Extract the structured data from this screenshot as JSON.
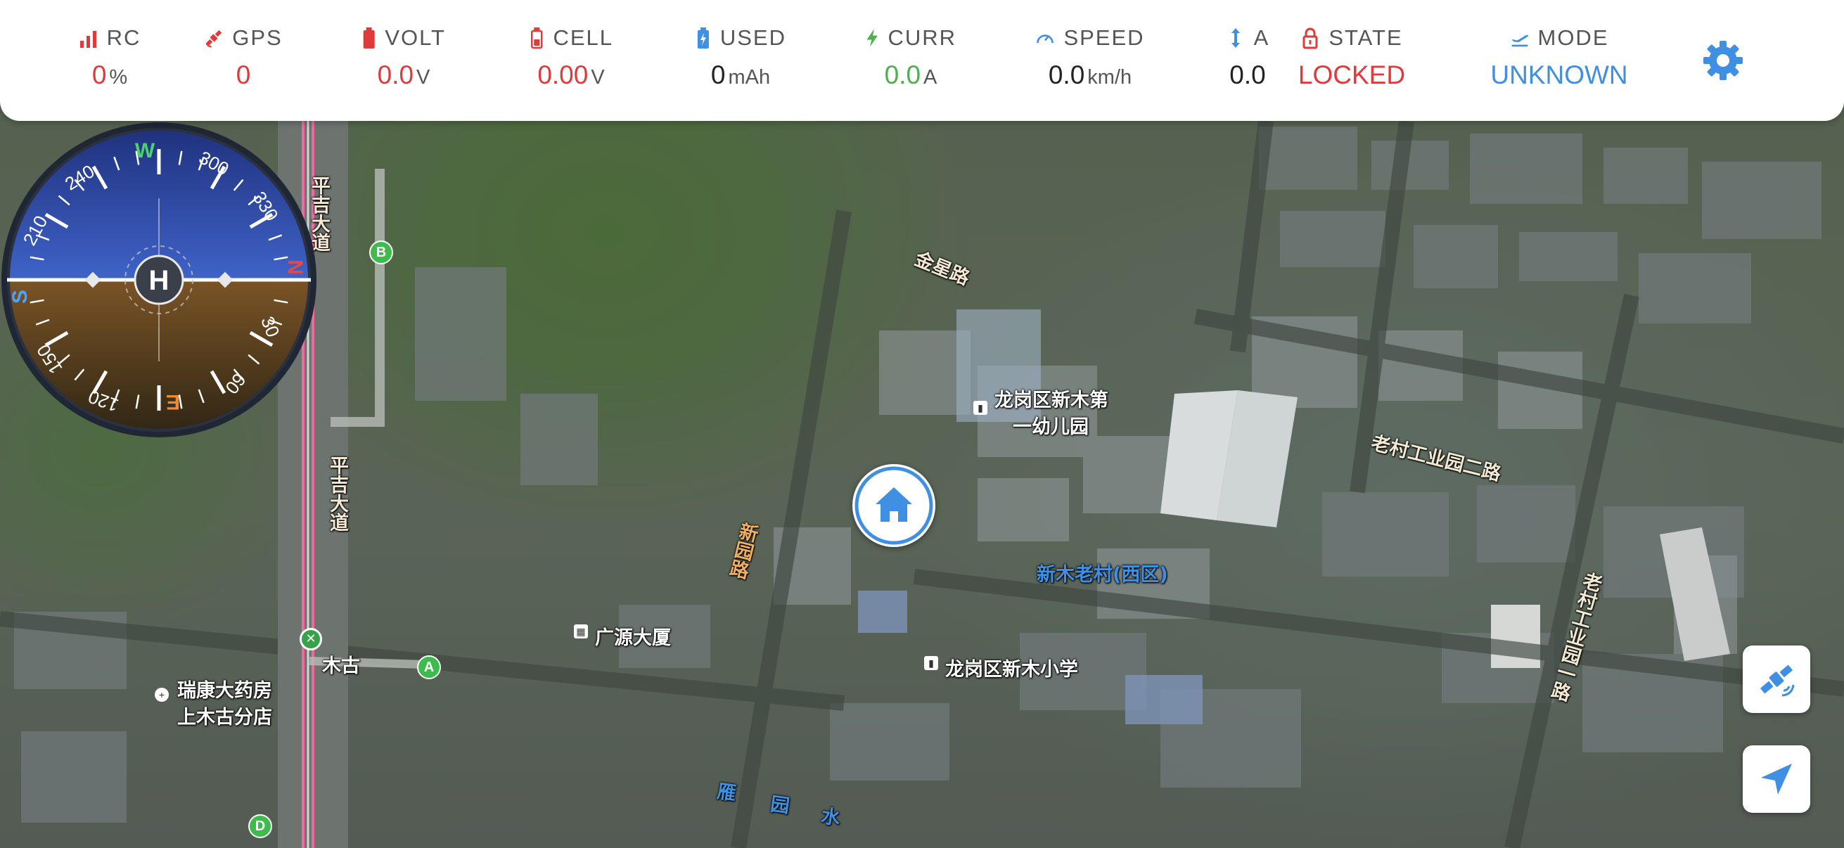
{
  "stats": [
    {
      "id": "rc",
      "label": "RC",
      "value": "0",
      "unit": "%",
      "icon": "signal-bars-icon"
    },
    {
      "id": "gps",
      "label": "GPS",
      "value": "0",
      "unit": "",
      "icon": "satellite-icon"
    },
    {
      "id": "volt",
      "label": "VOLT",
      "value": "0.0",
      "unit": "V",
      "icon": "battery-icon"
    },
    {
      "id": "cell",
      "label": "CELL",
      "value": "0.00",
      "unit": "V",
      "icon": "battery-cell-icon"
    },
    {
      "id": "used",
      "label": "USED",
      "value": "0",
      "unit": "mAh",
      "icon": "battery-charging-icon"
    },
    {
      "id": "curr",
      "label": "CURR",
      "value": "0.0",
      "unit": "A",
      "icon": "lightning-icon"
    },
    {
      "id": "speed",
      "label": "SPEED",
      "value": "0.0",
      "unit": "km/h",
      "icon": "speedometer-icon"
    },
    {
      "id": "alt",
      "label": "A",
      "value": "0.0",
      "unit": "",
      "icon": "vertical-arrows-icon"
    },
    {
      "id": "state",
      "label": "STATE",
      "value": "LOCKED",
      "unit": "",
      "icon": "lock-icon"
    },
    {
      "id": "mode",
      "label": "MODE",
      "value": "UNKNOWN",
      "unit": "",
      "icon": "airplane-takeoff-icon"
    }
  ],
  "colors": {
    "accent_blue": "#3f8fe3",
    "alert_red": "#e03a3a",
    "ok_green": "#4caf50",
    "compass_sky": "#2c47a8",
    "compass_ground": "#6b4a22"
  },
  "settings_icon": "gear-icon",
  "compass": {
    "center_letter": "H",
    "cardinals": {
      "N": "N",
      "E": "E",
      "S": "S",
      "W": "W"
    },
    "degree_labels": [
      "30",
      "60",
      "120",
      "150",
      "210",
      "240",
      "300",
      "330"
    ]
  },
  "home_marker_icon": "home-icon",
  "fab_buttons": [
    {
      "id": "satellite",
      "icon": "satellite-icon"
    },
    {
      "id": "locate",
      "icon": "navigation-arrow-icon"
    }
  ],
  "map": {
    "labels": [
      {
        "text": "平吉大道",
        "kind": "road"
      },
      {
        "text": "平吉大道",
        "kind": "road"
      },
      {
        "text": "金星路",
        "kind": "road"
      },
      {
        "text": "龙岗区新木第",
        "kind": "poi"
      },
      {
        "text": "一幼儿园",
        "kind": "poi"
      },
      {
        "text": "老村工业园二路",
        "kind": "road"
      },
      {
        "text": "新木老村(西区)",
        "kind": "blue"
      },
      {
        "text": "广源大厦",
        "kind": "poi"
      },
      {
        "text": "龙岗区新木小学",
        "kind": "poi"
      },
      {
        "text": "木古",
        "kind": "poi"
      },
      {
        "text": "瑞康大药房",
        "kind": "poi"
      },
      {
        "text": "上木古分店",
        "kind": "poi"
      },
      {
        "text": "老村工业园一路",
        "kind": "road"
      },
      {
        "text": "新园路",
        "kind": "orange"
      },
      {
        "text": "雁",
        "kind": "blue"
      },
      {
        "text": "园",
        "kind": "blue"
      },
      {
        "text": "水",
        "kind": "blue"
      }
    ],
    "metro_exits": [
      "B",
      "A",
      "D"
    ]
  }
}
